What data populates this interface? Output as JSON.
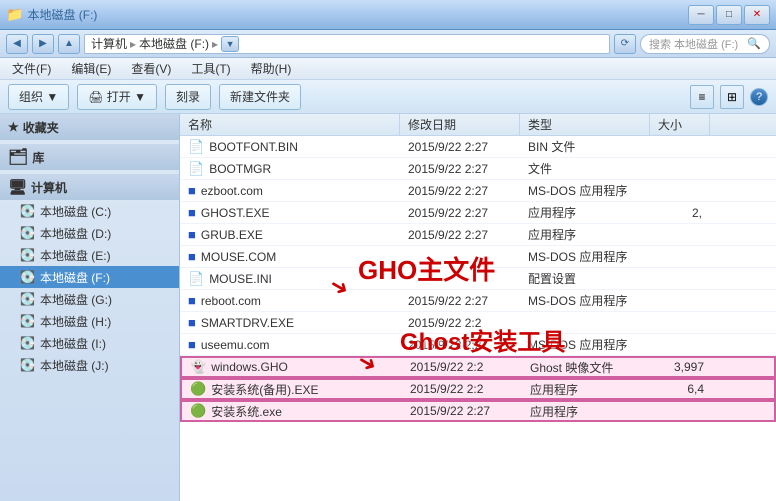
{
  "titleBar": {
    "title": "本地磁盘 (F:)",
    "minimizeLabel": "─",
    "maximizeLabel": "□",
    "closeLabel": "✕"
  },
  "addressBar": {
    "breadcrumb": "计算机 ▸ 本地磁盘 (F:) ▸",
    "searchPlaceholder": "搜索 本地磁盘 (F:)",
    "refreshIcon": "🔄"
  },
  "menuBar": {
    "items": [
      "文件(F)",
      "编辑(E)",
      "查看(V)",
      "工具(T)",
      "帮助(H)"
    ]
  },
  "toolbar": {
    "organizeLabel": "组织 ▼",
    "openLabel": "🖨 打开 ▼",
    "burnLabel": "刻录",
    "newFolderLabel": "新建文件夹",
    "helpIcon": "?"
  },
  "sidebar": {
    "sections": [
      {
        "name": "favorites",
        "label": "★ 收藏夹",
        "expanded": true,
        "items": []
      },
      {
        "name": "libraries",
        "label": "库",
        "expanded": true,
        "items": []
      },
      {
        "name": "computer",
        "label": "计算机",
        "expanded": true,
        "items": [
          {
            "label": "本地磁盘 (C:)",
            "icon": "💽"
          },
          {
            "label": "本地磁盘 (D:)",
            "icon": "💽"
          },
          {
            "label": "本地磁盘 (E:)",
            "icon": "💽"
          },
          {
            "label": "本地磁盘 (F:)",
            "icon": "💽",
            "selected": true
          },
          {
            "label": "本地磁盘 (G:)",
            "icon": "💽"
          },
          {
            "label": "本地磁盘 (H:)",
            "icon": "💽"
          },
          {
            "label": "本地磁盘 (I:)",
            "icon": "💽"
          },
          {
            "label": "本地磁盘 (J:)",
            "icon": "💽"
          }
        ]
      }
    ]
  },
  "fileList": {
    "columns": [
      "名称",
      "修改日期",
      "类型",
      "大小"
    ],
    "files": [
      {
        "name": "BOOTFONT.BIN",
        "icon": "📄",
        "date": "2015/9/22 2:27",
        "type": "BIN 文件",
        "size": ""
      },
      {
        "name": "BOOTMGR",
        "icon": "📄",
        "date": "2015/9/22 2:27",
        "type": "文件",
        "size": ""
      },
      {
        "name": "ezboot.com",
        "icon": "🔵",
        "date": "2015/9/22 2:27",
        "type": "MS-DOS 应用程序",
        "size": ""
      },
      {
        "name": "GHOST.EXE",
        "icon": "🔵",
        "date": "2015/9/22 2:27",
        "type": "应用程序",
        "size": "2,"
      },
      {
        "name": "GRUB.EXE",
        "icon": "🔵",
        "date": "2015/9/22 2:27",
        "type": "应用程序",
        "size": ""
      },
      {
        "name": "MOUSE.COM",
        "icon": "🔵",
        "date": "",
        "type": "MS-DOS 应用程序",
        "size": "",
        "annotation": "GHO主文件"
      },
      {
        "name": "MOUSE.INI",
        "icon": "📄",
        "date": "",
        "type": "配置设置",
        "size": "",
        "annotation": "Ghost安装工具"
      },
      {
        "name": "reboot.com",
        "icon": "🔵",
        "date": "2015/9/22 2:27",
        "type": "MS-DOS 应用程序",
        "size": ""
      },
      {
        "name": "SMARTDRV.EXE",
        "icon": "🔵",
        "date": "2015/9/22 2:2",
        "type": "",
        "size": ""
      },
      {
        "name": "useemu.com",
        "icon": "🔵",
        "date": "2015/9/22 2:27",
        "type": "MS-DOS 应用程序",
        "size": ""
      },
      {
        "name": "windows.GHO",
        "icon": "👻",
        "date": "2015/9/22 2:2",
        "type": "Ghost 映像文件",
        "size": "3,997",
        "highlighted": true
      },
      {
        "name": "安装系统(备用).EXE",
        "icon": "🟢",
        "date": "2015/9/22 2:2",
        "type": "应用程序",
        "size": "6,4",
        "highlighted": true
      },
      {
        "name": "安装系统.exe",
        "icon": "🟢",
        "date": "2015/9/22 2:27",
        "type": "应用程序",
        "size": "",
        "highlighted": true
      }
    ]
  },
  "annotations": {
    "ghoLabel": "GHO主文件",
    "ghostLabel": "Ghost安装工具"
  }
}
